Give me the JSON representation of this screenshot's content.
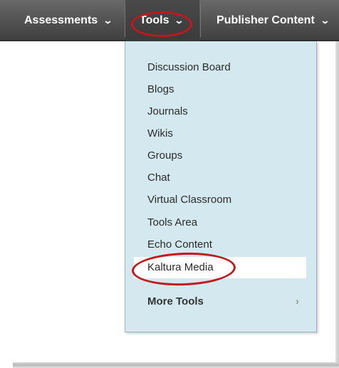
{
  "navbar": {
    "items": [
      {
        "label": "Assessments",
        "chevron": "⌄"
      },
      {
        "label": "Tools",
        "chevron": "⌄"
      },
      {
        "label": "Publisher Content",
        "chevron": "⌄"
      }
    ]
  },
  "dropdown": {
    "items": [
      {
        "label": "Discussion Board"
      },
      {
        "label": "Blogs"
      },
      {
        "label": "Journals"
      },
      {
        "label": "Wikis"
      },
      {
        "label": "Groups"
      },
      {
        "label": "Chat"
      },
      {
        "label": "Virtual Classroom"
      },
      {
        "label": "Tools Area"
      },
      {
        "label": "Echo Content"
      },
      {
        "label": "Kaltura Media"
      }
    ],
    "more_tools": {
      "label": "More Tools",
      "chevron": "›"
    }
  },
  "colors": {
    "navbar": "#555555",
    "dropdown_bg": "#d3e9ef",
    "annotation_circle": "#c4161c"
  }
}
